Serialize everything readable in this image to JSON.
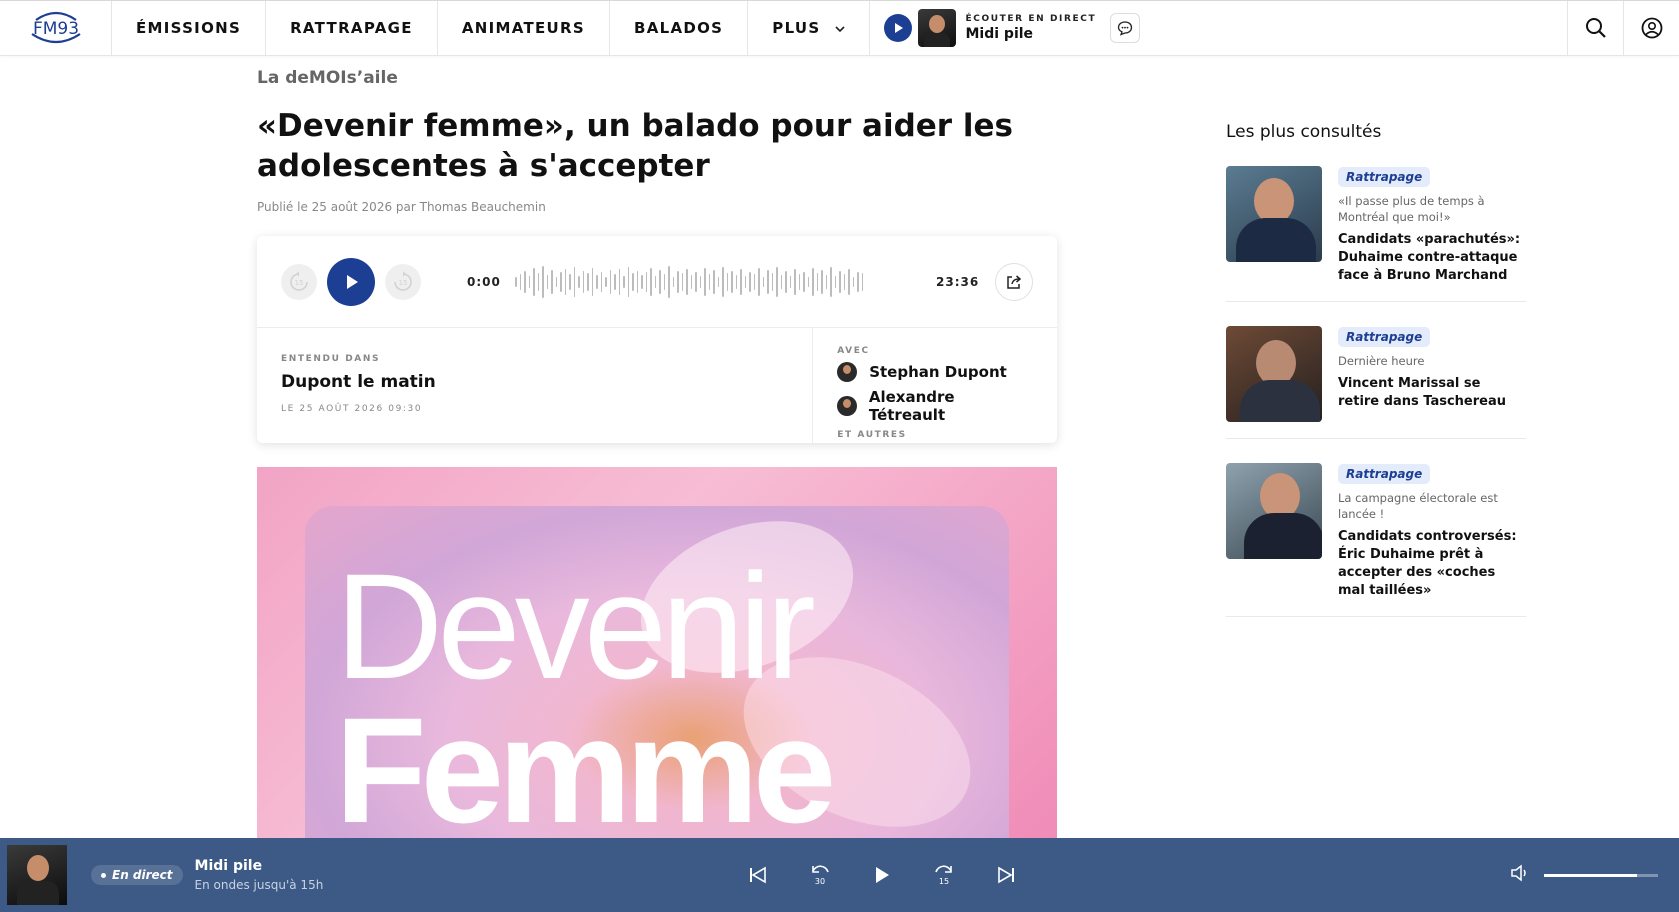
{
  "nav": {
    "logo": "FM93",
    "items": [
      "ÉMISSIONS",
      "RATTRAPAGE",
      "ANIMATEURS",
      "BALADOS",
      "PLUS"
    ],
    "live_kicker": "ÉCOUTER EN DIRECT",
    "live_show": "Midi pile"
  },
  "article": {
    "category": "La deMOIs’aile",
    "title": "«Devenir femme», un balado pour aider les adolescentes à s'accepter",
    "byline": "Publié le 25 août 2026 par Thomas Beauchemin",
    "player": {
      "current_time": "0:00",
      "total_time": "23:36",
      "skip_back": "15",
      "skip_forward": "15"
    },
    "heard_in": {
      "kicker": "ENTENDU DANS",
      "show": "Dupont le matin",
      "date": "LE 25 AOÛT 2026 09:30"
    },
    "with": {
      "kicker": "AVEC",
      "hosts": [
        "Stephan Dupont",
        "Alexandre Tétreault"
      ],
      "others": "ET AUTRES"
    },
    "hero": {
      "line1": "Devenir",
      "line2": "Femme"
    }
  },
  "sidebar": {
    "title": "Les plus consultés",
    "items": [
      {
        "tag": "Rattrapage",
        "sub": "«Il passe plus de temps à Montréal que moi!»",
        "headline": "Candidats «parachutés»: Duhaime contre-attaque face à Bruno Marchand"
      },
      {
        "tag": "Rattrapage",
        "sub": "Dernière heure",
        "headline": "Vincent Marissal se retire dans Taschereau"
      },
      {
        "tag": "Rattrapage",
        "sub": "La campagne électorale est lancée !",
        "headline": "Candidats controversés: Éric Duhaime prêt à accepter des «coches mal taillées»"
      }
    ]
  },
  "bottom_player": {
    "badge": "En direct",
    "show": "Midi pile",
    "sub": "En ondes jusqu'à 15h",
    "rewind": "30",
    "forward": "15",
    "volume": 0.82
  },
  "colors": {
    "brand_blue": "#1c3f94",
    "player_bar": "#3d5a86",
    "tag_bg": "#e4ebfa"
  }
}
